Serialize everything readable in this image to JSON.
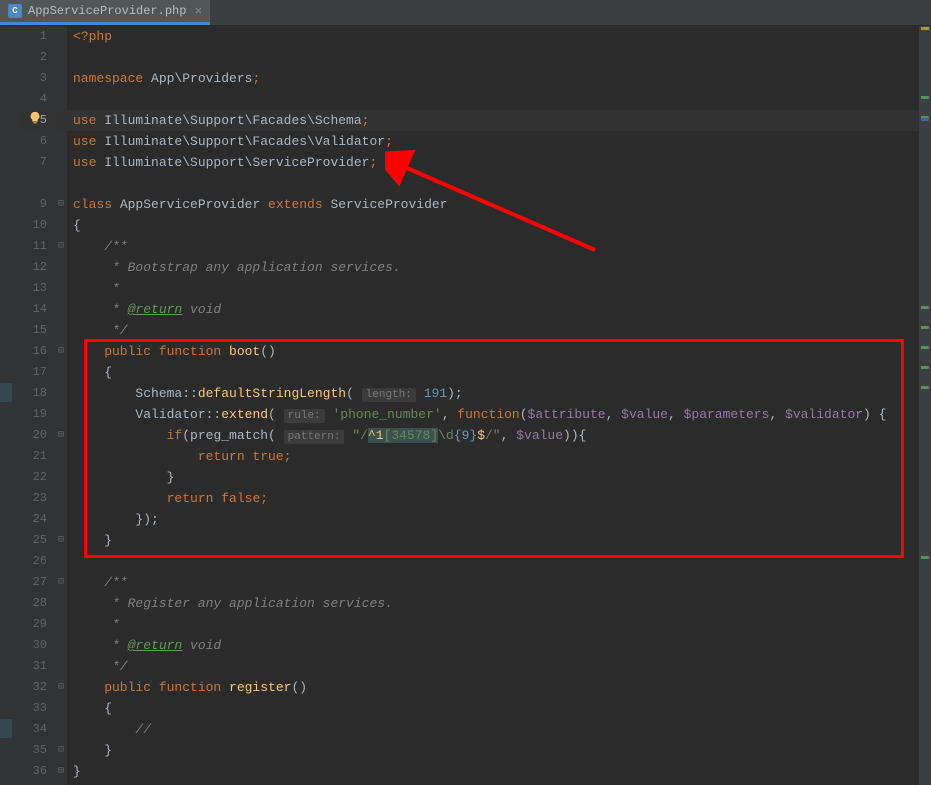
{
  "tab": {
    "icon_letter": "C",
    "label": "AppServiceProvider.php",
    "close": "×"
  },
  "gutter": [
    "1",
    "2",
    "3",
    "4",
    "5",
    "6",
    "7",
    "",
    "9",
    "10",
    "11",
    "12",
    "13",
    "14",
    "15",
    "16",
    "17",
    "18",
    "19",
    "20",
    "21",
    "22",
    "23",
    "24",
    "25",
    "26",
    "27",
    "28",
    "29",
    "30",
    "31",
    "32",
    "33",
    "34",
    "35",
    "36"
  ],
  "fold": [
    "",
    "",
    "",
    "",
    "",
    "",
    "",
    "",
    "⊟",
    "",
    "⊟",
    "",
    "",
    "",
    "",
    "⊟",
    "",
    "",
    "",
    "⊟",
    "",
    "",
    "",
    "",
    "⊟",
    "",
    "⊟",
    "",
    "",
    "",
    "",
    "⊟",
    "",
    "",
    "⊟",
    "⊟"
  ],
  "code": {
    "l1": {
      "php_open": "<?php"
    },
    "l3": {
      "ns": "namespace",
      "path": " App\\Providers",
      "semi": ";"
    },
    "l5": {
      "use": "use",
      "path": " Illuminate\\Support\\Facades\\Schema",
      "semi": ";"
    },
    "l6": {
      "use": "use",
      "path": " Illuminate\\Support\\Facades\\Validator",
      "semi": ";"
    },
    "l7": {
      "use": "use",
      "path": " Illuminate\\Support\\ServiceProvider",
      "semi": ";"
    },
    "l9": {
      "class": "class",
      "name": " AppServiceProvider ",
      "ext": "extends",
      "base": " ServiceProvider"
    },
    "l10": {
      "brace": "{"
    },
    "l11": {
      "c": "    /**"
    },
    "l12": {
      "c": "     * Bootstrap any application services."
    },
    "l13": {
      "c": "     *"
    },
    "l14": {
      "c1": "     * ",
      "tag": "@return",
      "c2": " void"
    },
    "l15": {
      "c": "     */"
    },
    "l16": {
      "pub": "    public function ",
      "fn": "boot",
      "paren": "()"
    },
    "l17": {
      "b": "    {"
    },
    "l18": {
      "pre": "        Schema::",
      "fn": "defaultStringLength",
      "op": "( ",
      "hint": "length:",
      "sp": " ",
      "num": "191",
      "cl": ");"
    },
    "l19": {
      "pre": "        Validator::",
      "fn": "extend",
      "op": "( ",
      "hint": "rule:",
      "sp": " ",
      "str": "'phone_number'",
      "mid": ", ",
      "kw": "function",
      "op2": "(",
      "v1": "$attribute",
      "c1": ", ",
      "v2": "$value",
      "c2": ", ",
      "v3": "$parameters",
      "c3": ", ",
      "v4": "$validator",
      "cl": ") {"
    },
    "l20": {
      "pre": "            ",
      "if": "if",
      "op": "(preg_match( ",
      "hint": "pattern:",
      "sp": " ",
      "s1": "\"/",
      "s2": "^1",
      "s3": "[",
      "s4": "34578",
      "s5": "]",
      "s6": "\\d",
      "s7": "{",
      "s8": "9",
      "s9": "}",
      "s10": "$",
      "s11": "/\"",
      "mid": ", ",
      "var": "$value",
      "cl": ")){"
    },
    "l21": {
      "pre": "                ",
      "ret": "return true",
      "semi": ";"
    },
    "l22": {
      "b": "            }"
    },
    "l23": {
      "pre": "            ",
      "ret": "return false",
      "semi": ";"
    },
    "l24": {
      "b": "        });"
    },
    "l25": {
      "b": "    }"
    },
    "l27": {
      "c": "    /**"
    },
    "l28": {
      "c": "     * Register any application services."
    },
    "l29": {
      "c": "     *"
    },
    "l30": {
      "c1": "     * ",
      "tag": "@return",
      "c2": " void"
    },
    "l31": {
      "c": "     */"
    },
    "l32": {
      "pub": "    public function ",
      "fn": "register",
      "paren": "()"
    },
    "l33": {
      "b": "    {"
    },
    "l34": {
      "b": "        //"
    },
    "l35": {
      "b": "    }"
    },
    "l36": {
      "b": "}"
    }
  }
}
